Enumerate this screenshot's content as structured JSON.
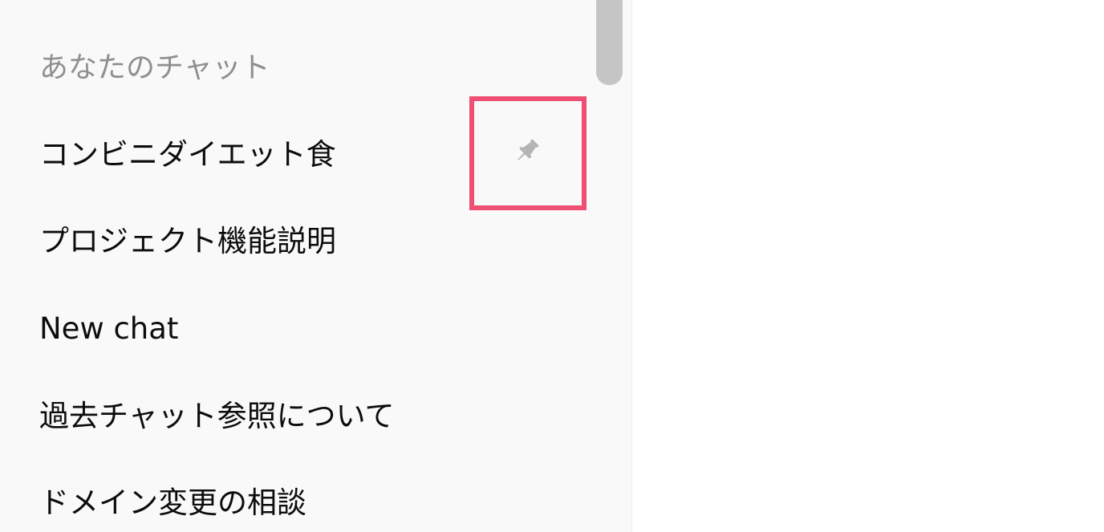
{
  "sidebar": {
    "section_heading": "あなたのチャット",
    "chats": [
      {
        "label": "コンビニダイエット食",
        "pin_icon": "pin-icon"
      },
      {
        "label": "プロジェクト機能説明"
      },
      {
        "label": "New chat"
      },
      {
        "label": "過去チャット参照について"
      },
      {
        "label": "ドメイン変更の相談"
      }
    ]
  },
  "colors": {
    "highlight": "#ef4f73",
    "sidebar_bg": "#f9f9f9",
    "heading_text": "#8f8f8f",
    "item_text": "#0d0d0d",
    "pin_icon": "#b4b4b4",
    "scrollbar": "#c5c5c5"
  }
}
